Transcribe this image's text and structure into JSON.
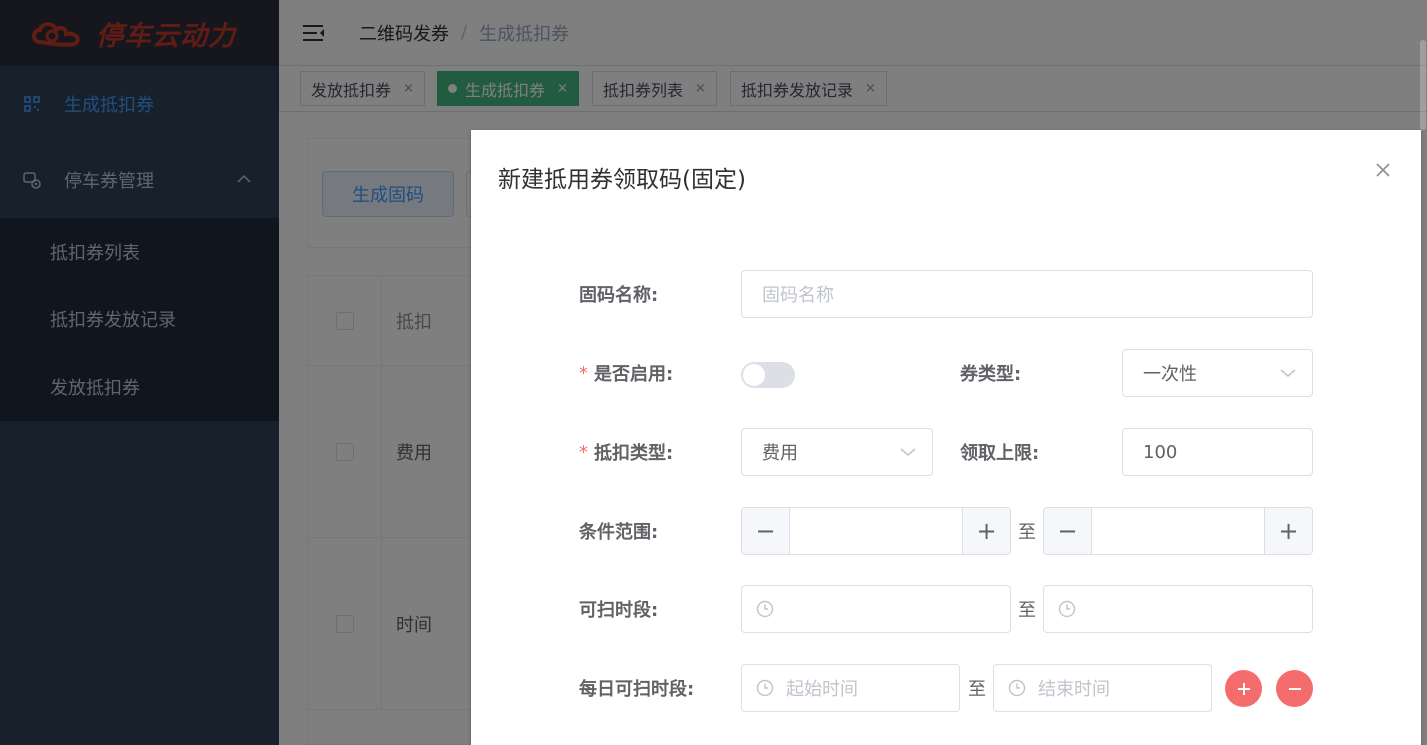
{
  "app": {
    "brand": "停车云动力",
    "brand_color": "#c0392b"
  },
  "sidebar": {
    "items": [
      {
        "label": "生成抵扣券",
        "icon": "qrcode-icon",
        "active": true
      },
      {
        "label": "停车券管理",
        "icon": "coupon-manage-icon",
        "expanded": true
      }
    ],
    "subitems": [
      "抵扣券列表",
      "抵扣券发放记录",
      "发放抵扣券"
    ]
  },
  "header": {
    "breadcrumb": [
      "二维码发券",
      "生成抵扣券"
    ],
    "separator": "/"
  },
  "tags": [
    {
      "label": "发放抵扣券",
      "close": "×"
    },
    {
      "label": "生成抵扣券",
      "close": "×",
      "active": true
    },
    {
      "label": "抵扣券列表",
      "close": "×"
    },
    {
      "label": "抵扣券发放记录",
      "close": "×"
    }
  ],
  "main": {
    "generate_button": "生成固码",
    "table": {
      "header": "抵扣",
      "rows": [
        "费用",
        "时间"
      ]
    }
  },
  "dialog": {
    "title": "新建抵用券领取码(固定)",
    "fields": {
      "name": {
        "label": "固码名称:",
        "placeholder": "固码名称"
      },
      "enabled": {
        "label": "是否启用:",
        "required": true,
        "value": false
      },
      "coupon_type": {
        "label": "券类型:",
        "value": "一次性"
      },
      "deduct_type": {
        "label": "抵扣类型:",
        "required": true,
        "value": "费用"
      },
      "claim_limit": {
        "label": "领取上限:",
        "value": "100"
      },
      "condition_range": {
        "label": "条件范围:",
        "minus": "−",
        "plus": "+"
      },
      "scan_period": {
        "label": "可扫时段:"
      },
      "daily_scan_period": {
        "label": "每日可扫时段:",
        "start_placeholder": "起始时间",
        "end_placeholder": "结束时间"
      }
    },
    "to_text": "至",
    "required_mark": "*"
  },
  "colors": {
    "accent": "#409eff",
    "tag_active": "#42b983",
    "danger": "#f56c6c"
  }
}
